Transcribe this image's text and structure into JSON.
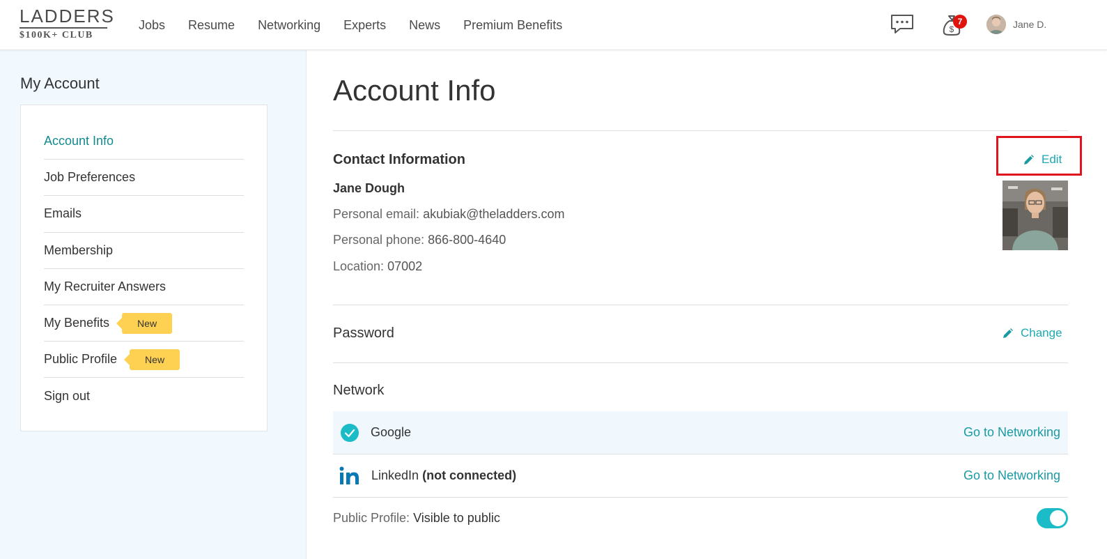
{
  "logo": {
    "top": "LADDERS",
    "bottom": "$100K+ CLUB"
  },
  "nav": {
    "items": [
      "Jobs",
      "Resume",
      "Networking",
      "Experts",
      "News",
      "Premium Benefits"
    ]
  },
  "header": {
    "notification_count": "7",
    "user_name": "Jane D."
  },
  "sidebar": {
    "title": "My Account",
    "items": [
      {
        "label": "Account Info",
        "active": true
      },
      {
        "label": "Job Preferences"
      },
      {
        "label": "Emails"
      },
      {
        "label": "Membership"
      },
      {
        "label": "My Recruiter Answers"
      },
      {
        "label": "My Benefits",
        "tag": "New"
      },
      {
        "label": "Public Profile",
        "tag": "New"
      },
      {
        "label": "Sign out"
      }
    ]
  },
  "main": {
    "title": "Account Info",
    "contact": {
      "heading": "Contact Information",
      "edit_label": "Edit",
      "name": "Jane Dough",
      "email_label": "Personal email:",
      "email": "akubiak@theladders.com",
      "phone_label": "Personal phone:",
      "phone": "866-800-4640",
      "location_label": "Location:",
      "location": "07002"
    },
    "password": {
      "heading": "Password",
      "change_label": "Change"
    },
    "network": {
      "heading": "Network",
      "google": {
        "label": "Google",
        "link": "Go to Networking"
      },
      "linkedin": {
        "label": "LinkedIn",
        "status": "(not connected)",
        "link": "Go to Networking"
      }
    },
    "public_profile": {
      "label": "Public Profile:",
      "value": "Visible to public",
      "enabled": true
    }
  },
  "colors": {
    "accent": "#1ba9b3",
    "active_nav": "#128a8e",
    "badge": "#e0140f",
    "tag": "#ffd152",
    "highlight_box": "#e0141f"
  }
}
